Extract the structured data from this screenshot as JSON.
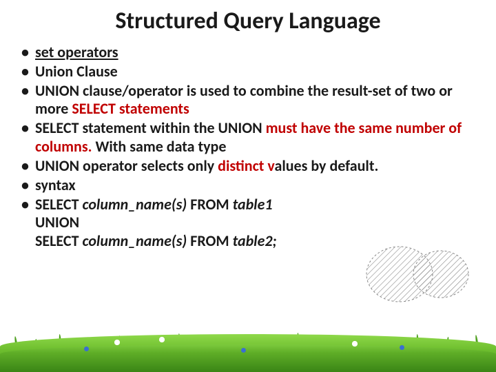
{
  "title": "Structured Query Language",
  "bullets": {
    "b1": "set operators",
    "b2": "Union Clause",
    "b3_a": "UNION clause/operator is used to combine the result-set of two or more ",
    "b3_b": "SELECT statements",
    "b4_a": "SELECT statement within the UNION ",
    "b4_b": "must have the same number of columns. ",
    "b4_c": "With same data type",
    "b5_a": "UNION operator selects only ",
    "b5_b": "distinct v",
    "b5_c": "alues by default.",
    "b6": "syntax",
    "b7_a": "SELECT ",
    "b7_b": "column_name(s) ",
    "b7_c": "FROM ",
    "b7_d": "table1",
    "b7_e": "UNION",
    "b7_f": "SELECT ",
    "b7_g": "column_name(s) ",
    "b7_h": "FROM ",
    "b7_i": "table2;"
  }
}
